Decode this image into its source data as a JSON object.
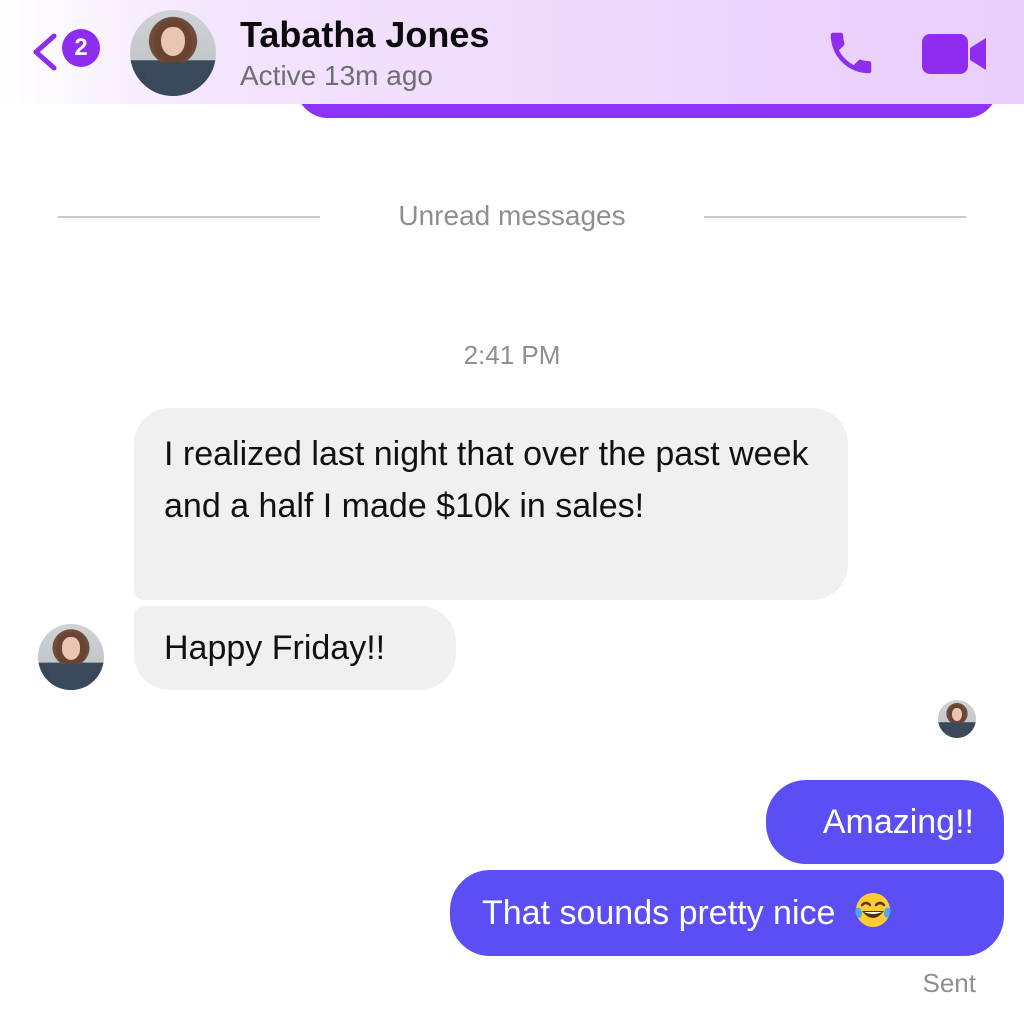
{
  "header": {
    "contact_name": "Tabatha Jones",
    "status": "Active 13m ago",
    "back_badge_count": "2",
    "icons": [
      "chevron-left-icon",
      "phone-icon",
      "video-camera-icon"
    ],
    "accent_color": "#8e2cf0"
  },
  "conversation": {
    "divider_label": "Unread messages",
    "timestamp": "2:41 PM",
    "incoming_messages": [
      {
        "text": "I realized last night that over the past week and a half I made $10k in sales!"
      },
      {
        "text": "Happy Friday!!"
      }
    ],
    "outgoing_messages": [
      {
        "text": "Amazing!!"
      },
      {
        "text": "That sounds pretty nice",
        "emoji": "face-with-tears-of-joy"
      }
    ],
    "delivery_status": "Sent",
    "incoming_bubble_color": "#f0f0f1",
    "outgoing_bubble_color": "#5a4ef4"
  }
}
